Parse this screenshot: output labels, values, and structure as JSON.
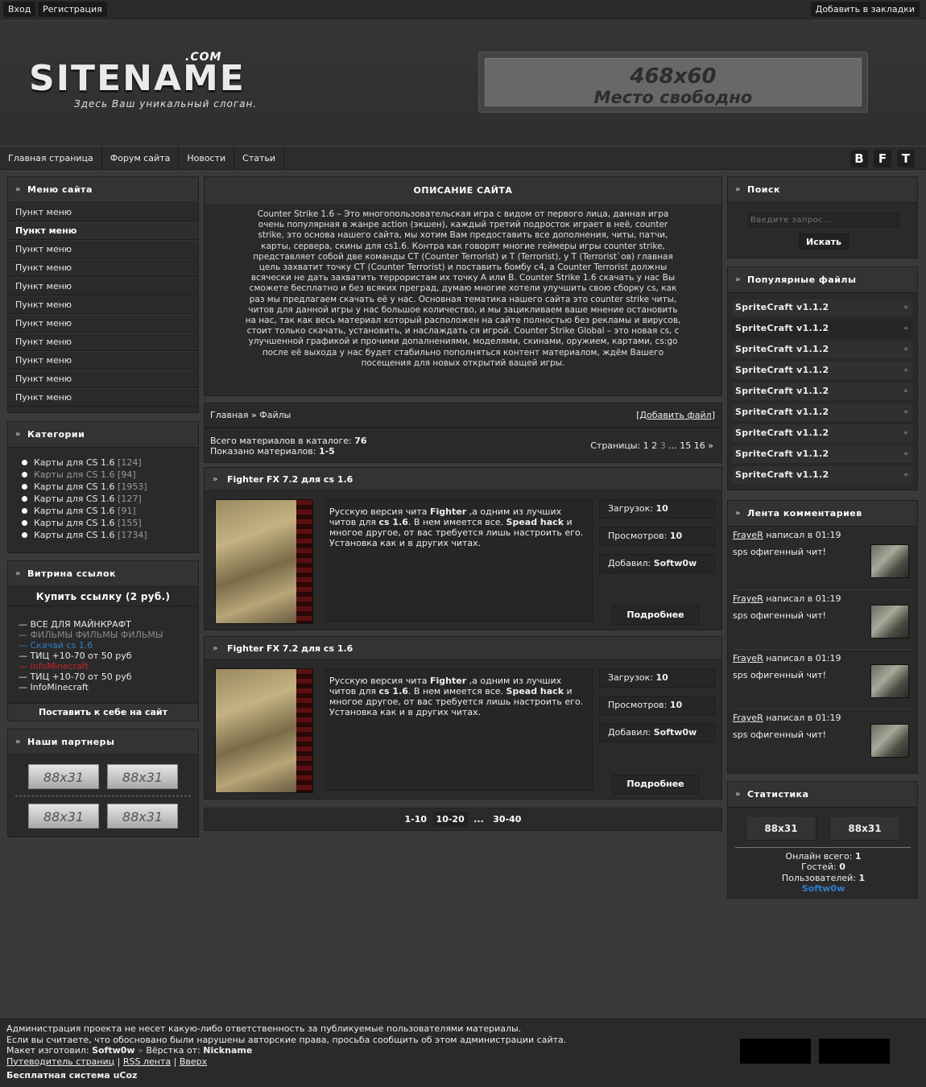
{
  "topbar": {
    "login": "Вход",
    "register": "Регистрация",
    "bookmark": "Добавить в закладки"
  },
  "header": {
    "logo_com": ".COM",
    "logo_name": "SITENAME",
    "slogan": "Здесь Ваш уникальный слоган.",
    "banner_size": "468x60",
    "banner_text": "Место свободно"
  },
  "nav": {
    "items": [
      "Главная страница",
      "Форум сайта",
      "Новости",
      "Статьи"
    ],
    "social": [
      "B",
      "F",
      "T"
    ]
  },
  "menu": {
    "title": "Меню сайта",
    "items": [
      "Пункт меню",
      "Пункт меню",
      "Пункт меню",
      "Пункт меню",
      "Пункт меню",
      "Пункт меню",
      "Пункт меню",
      "Пункт меню",
      "Пункт меню",
      "Пункт меню",
      "Пункт меню"
    ],
    "active_index": 1
  },
  "categories": {
    "title": "Категории",
    "items": [
      {
        "name": "Карты для CS 1.6",
        "count": "[124]"
      },
      {
        "name": "Карты для CS 1.6",
        "count": "[94]"
      },
      {
        "name": "Карты для CS 1.6",
        "count": "[1953]"
      },
      {
        "name": "Карты для CS 1.6",
        "count": "[127]"
      },
      {
        "name": "Карты для CS 1.6",
        "count": "[91]"
      },
      {
        "name": "Карты для CS 1.6",
        "count": "[155]"
      },
      {
        "name": "Карты для CS 1.6",
        "count": "[1734]"
      }
    ]
  },
  "links": {
    "title": "Витрина ссылок",
    "buy": "Купить ссылку (2 руб.)",
    "items": [
      {
        "text": "— ВСЕ ДЛЯ МАЙНКРАФТ",
        "color": "#eaeaea"
      },
      {
        "text": "— ФИЛЬМЫ ФИЛЬМЫ ФИЛЬМЫ",
        "color": "#8a8a8a"
      },
      {
        "text": "— Скачай cs 1.6",
        "color": "#2f7fc7"
      },
      {
        "text": "— ТИЦ +10-70 от 50 руб",
        "color": "#eaeaea"
      },
      {
        "text": "— InfoMinecraft",
        "color": "#c62525"
      },
      {
        "text": "— ТИЦ +10-70 от 50 руб",
        "color": "#eaeaea"
      },
      {
        "text": "— InfoMinecraft",
        "color": "#eaeaea"
      }
    ],
    "install": "Поставить к себе на сайт"
  },
  "partners": {
    "title": "Наши партнеры",
    "buttons": [
      "88x31",
      "88x31",
      "88x31",
      "88x31"
    ]
  },
  "description": {
    "title": "ОПИСАНИЕ САЙТА",
    "text": "Counter Strike 1.6 – Это многопользовательская игра с видом от первого лица, данная игра очень популярная в жанре action (экшен), каждый третий подросток играет в неё, counter strike, это основа нашего сайта, мы хотим Вам предоставить все дополнения, читы, патчи, карты, сервера, скины для cs1.6. Контра как говорят многие геймеры игры counter strike, представляет собой две команды CT (Counter Terrorist) и T (Terrorist), у T (Terrorist`ов) главная цель захватит точку CT (Counter Terrorist) и поставить бомбу c4, а Counter Terrorist должны всячески не дать захватить террористам их точку A или B. Counter Strike 1.6 скачать у нас Вы сможете бесплатно и без всяких преград, думаю многие хотели улучшить свою сборку cs, как раз мы предлагаем скачать её у нас. Основная тематика нашего сайта это counter strike читы, читов для данной игры у нас большое количество, и мы зацикливаем ваше мнение остановить на нас, так как весь материал который расположен на сайте полностью без рекламы и вирусов, стоит только скачать, установить, и наслаждать ся игрой. Counter Strike Global – это новая cs, с улучшенной графикой и прочими допалнениями, моделями, скинами, оружием, картами, cs:go после её выхода у нас будет стабильно пополняться контент материалом, ждём Вашего посещения для новых открытий ващей игры."
  },
  "breadcrumb": {
    "home": "Главная",
    "sep": "»",
    "current": "Файлы",
    "add_file": "Добавить файл"
  },
  "catalog": {
    "total_label": "Всего материалов в каталоге:",
    "total": "76",
    "shown_label": "Показано материалов:",
    "shown": "1-5",
    "pages_label": "Страницы:",
    "pages": [
      "1",
      "2",
      "3",
      "...",
      "15",
      "16",
      "»"
    ]
  },
  "files": [
    {
      "title": "Fighter FX 7.2 для cs 1.6",
      "desc_parts": [
        "Русскую версия чита ",
        "Fighter",
        " ,а одним из лучших читов для ",
        "cs 1.6",
        ". В нем имеется все. ",
        "Spead hack",
        " и многое другое, от вас требуется лишь настроить его. Установка как и в других читах."
      ],
      "downloads_label": "Загрузок:",
      "downloads": "10",
      "views_label": "Просмотров:",
      "views": "10",
      "added_label": "Добавил:",
      "added_by": "Softw0w",
      "more": "Подробнее"
    },
    {
      "title": "Fighter FX 7.2 для cs 1.6",
      "desc_parts": [
        "Русскую версия чита ",
        "Fighter",
        " ,а одним из лучших читов для ",
        "cs 1.6",
        ". В нем имеется все. ",
        "Spead hack",
        " и многое другое, от вас требуется лишь настроить его. Установка как и в других читах."
      ],
      "downloads_label": "Загрузок:",
      "downloads": "10",
      "views_label": "Просмотров:",
      "views": "10",
      "added_label": "Добавил:",
      "added_by": "Softw0w",
      "more": "Подробнее"
    }
  ],
  "pager": [
    "1-10",
    "10-20",
    "...",
    "30-40"
  ],
  "search": {
    "title": "Поиск",
    "placeholder": "Введите запрос...",
    "button": "Искать"
  },
  "popular": {
    "title": "Популярные файлы",
    "items": [
      "SpriteCraft v1.1.2",
      "SpriteCraft v1.1.2",
      "SpriteCraft v1.1.2",
      "SpriteCraft v1.1.2",
      "SpriteCraft v1.1.2",
      "SpriteCraft v1.1.2",
      "SpriteCraft v1.1.2",
      "SpriteCraft v1.1.2",
      "SpriteCraft v1.1.2"
    ]
  },
  "comments": {
    "title": "Лента комментариев",
    "items": [
      {
        "user": "FrayeR",
        "wrote": "написал в",
        "time": "01:19",
        "text": "sps офигенный чит!"
      },
      {
        "user": "FrayeR",
        "wrote": "написал в",
        "time": "01:19",
        "text": "sps офигенный чит!"
      },
      {
        "user": "FrayeR",
        "wrote": "написал в",
        "time": "01:19",
        "text": "sps офигенный чит!"
      },
      {
        "user": "FrayeR",
        "wrote": "написал в",
        "time": "01:19",
        "text": "sps офигенный чит!"
      }
    ]
  },
  "stats": {
    "title": "Статистика",
    "buttons": [
      "88x31",
      "88x31"
    ],
    "online_label": "Онлайн всего:",
    "online": "1",
    "guests_label": "Гостей:",
    "guests": "0",
    "users_label": "Пользователей:",
    "users": "1",
    "user_name": "Softw0w",
    "user_color": "#2f7fc7"
  },
  "footer": {
    "line1": "Администрация проекта не несет какую-либо ответственность за публикуемые пользователями материалы.",
    "line2": "Если вы считаете, что обосновано были нарушены авторские права, просьба сообщить об этом администрации сайта.",
    "made_label": "Макет изготовил:",
    "made_by": "Softw0w",
    "layout_label": "Вёрстка от:",
    "layout_by": "Nickname",
    "link1": "Путеводитель страниц",
    "link2": "RSS лента",
    "link3": "Вверх",
    "sep": "|",
    "ucoz": "Бесплатная система uCoz"
  }
}
